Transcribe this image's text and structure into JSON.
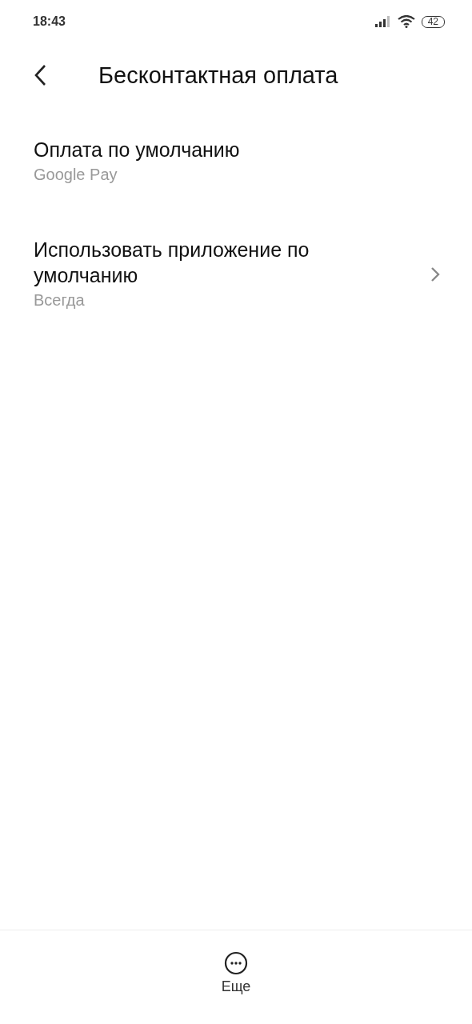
{
  "status_bar": {
    "time": "18:43",
    "battery": "42"
  },
  "header": {
    "title": "Бесконтактная оплата"
  },
  "items": [
    {
      "kind": "value",
      "title": "Оплата по умолчанию",
      "subtitle": "Google Pay"
    },
    {
      "kind": "link",
      "title": "Использовать приложение по умолчанию",
      "subtitle": "Всегда"
    }
  ],
  "bottom_bar": {
    "label": "Еще"
  }
}
